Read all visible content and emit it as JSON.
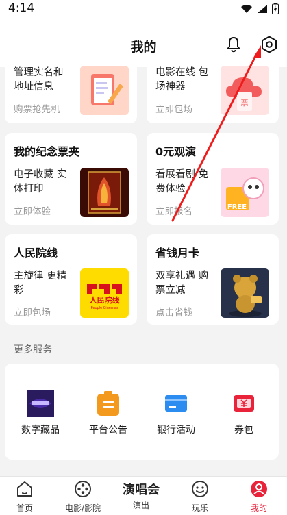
{
  "status": {
    "time": "4:14"
  },
  "header": {
    "title": "我的"
  },
  "cards": [
    {
      "desc": "管理实名和地址信息",
      "action": "购票抢先机"
    },
    {
      "desc": "电影在线 包场神器",
      "action": "立即包场"
    },
    {
      "title": "我的纪念票夹",
      "desc": "电子收藏 实体打印",
      "action": "立即体验"
    },
    {
      "title": "0元观演",
      "desc": "看展看剧 免费体验",
      "action": "立即报名"
    },
    {
      "title": "人民院线",
      "desc": "主旋律 更精彩",
      "action": "立即包场"
    },
    {
      "title": "省钱月卡",
      "desc": "双享礼遇 购票立减",
      "action": "点击省钱"
    }
  ],
  "services": {
    "section_title": "更多服务",
    "items": [
      {
        "label": "数字藏品",
        "icon": "digital-collection-icon"
      },
      {
        "label": "平台公告",
        "icon": "announcement-icon"
      },
      {
        "label": "银行活动",
        "icon": "bank-card-icon"
      },
      {
        "label": "券包",
        "icon": "coupon-icon"
      }
    ]
  },
  "tabs": [
    {
      "label": "首页",
      "icon": "home-icon"
    },
    {
      "label": "电影/影院",
      "icon": "film-reel-icon"
    },
    {
      "label": "演出",
      "icon": "performance-icon",
      "logo": "演唱会"
    },
    {
      "label": "玩乐",
      "icon": "smile-icon"
    },
    {
      "label": "我的",
      "icon": "profile-icon",
      "active": true
    }
  ],
  "thumb_text": {
    "cloud_badge": "票",
    "free_badge": "FREE",
    "cinema_logo": "人民院线",
    "cinema_logo_en": "People Cinemas"
  },
  "colors": {
    "accent": "#e8233a",
    "orange": "#f39a1e",
    "blue": "#2d8cf0",
    "background": "#f3f3f3"
  }
}
